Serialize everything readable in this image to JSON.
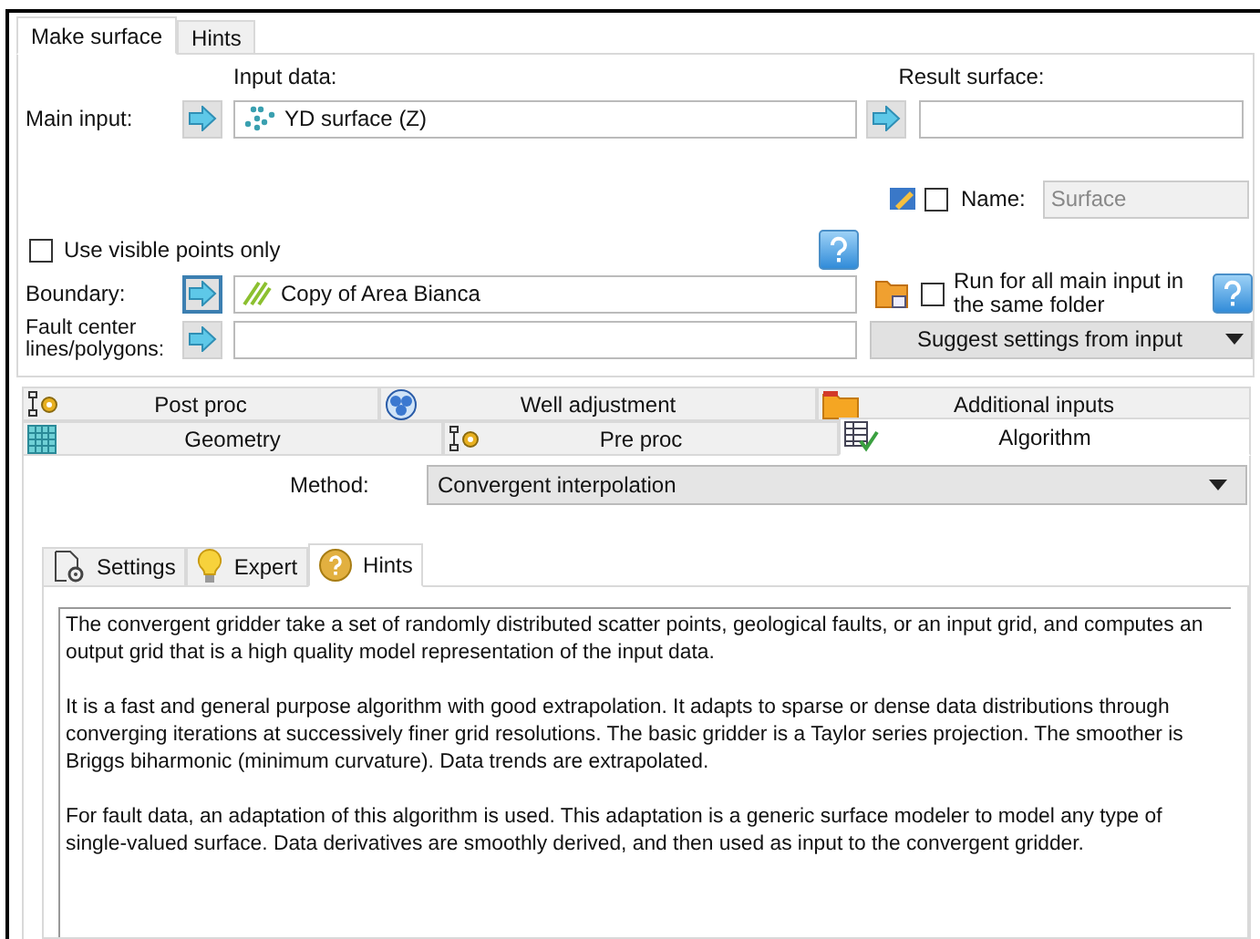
{
  "top_tabs": [
    {
      "label": "Make surface",
      "selected": true
    },
    {
      "label": "Hints",
      "selected": false
    }
  ],
  "input_data_label": "Input data:",
  "result_surface_label": "Result surface:",
  "main_input": {
    "label": "Main input:",
    "value": "YD surface (Z)"
  },
  "name": {
    "label": "Name:",
    "checked": false,
    "value": "Surface"
  },
  "use_visible_points": {
    "label": "Use visible points only",
    "checked": false
  },
  "boundary": {
    "label": "Boundary:",
    "value": "Copy of Area Bianca"
  },
  "run_for_all": {
    "label": "Run for all main input in the same folder",
    "checked": false
  },
  "fault_center": {
    "label": "Fault center lines/polygons:"
  },
  "suggest_button": "Suggest settings from input",
  "algorithm_tab_rows": [
    [
      {
        "label": "Post proc",
        "selected": false
      },
      {
        "label": "Well adjustment",
        "selected": false
      },
      {
        "label": "Additional inputs",
        "selected": false
      }
    ],
    [
      {
        "label": "Geometry",
        "selected": false
      },
      {
        "label": "Pre proc",
        "selected": false
      },
      {
        "label": "Algorithm",
        "selected": true
      }
    ]
  ],
  "method": {
    "label": "Method:",
    "value": "Convergent interpolation"
  },
  "sub_tabs": [
    {
      "label": "Settings",
      "selected": false
    },
    {
      "label": "Expert",
      "selected": false
    },
    {
      "label": "Hints",
      "selected": true
    }
  ],
  "hints_text": [
    "The convergent gridder take a set of randomly distributed scatter points, geological faults, or an input grid, and computes an output grid that is a high quality model representation of the input data.",
    "It is a fast and general purpose algorithm with good extrapolation. It adapts to sparse or dense data distributions through converging iterations at successively finer grid resolutions. The basic gridder is a Taylor series projection. The smoother is Briggs biharmonic (minimum curvature). Data trends are extrapolated.",
    "For fault data, an adaptation of this algorithm is used. This adaptation is a generic surface modeler to model any type of single-valued surface. Data derivatives are smoothly derived, and then used as input to the convergent gridder."
  ]
}
